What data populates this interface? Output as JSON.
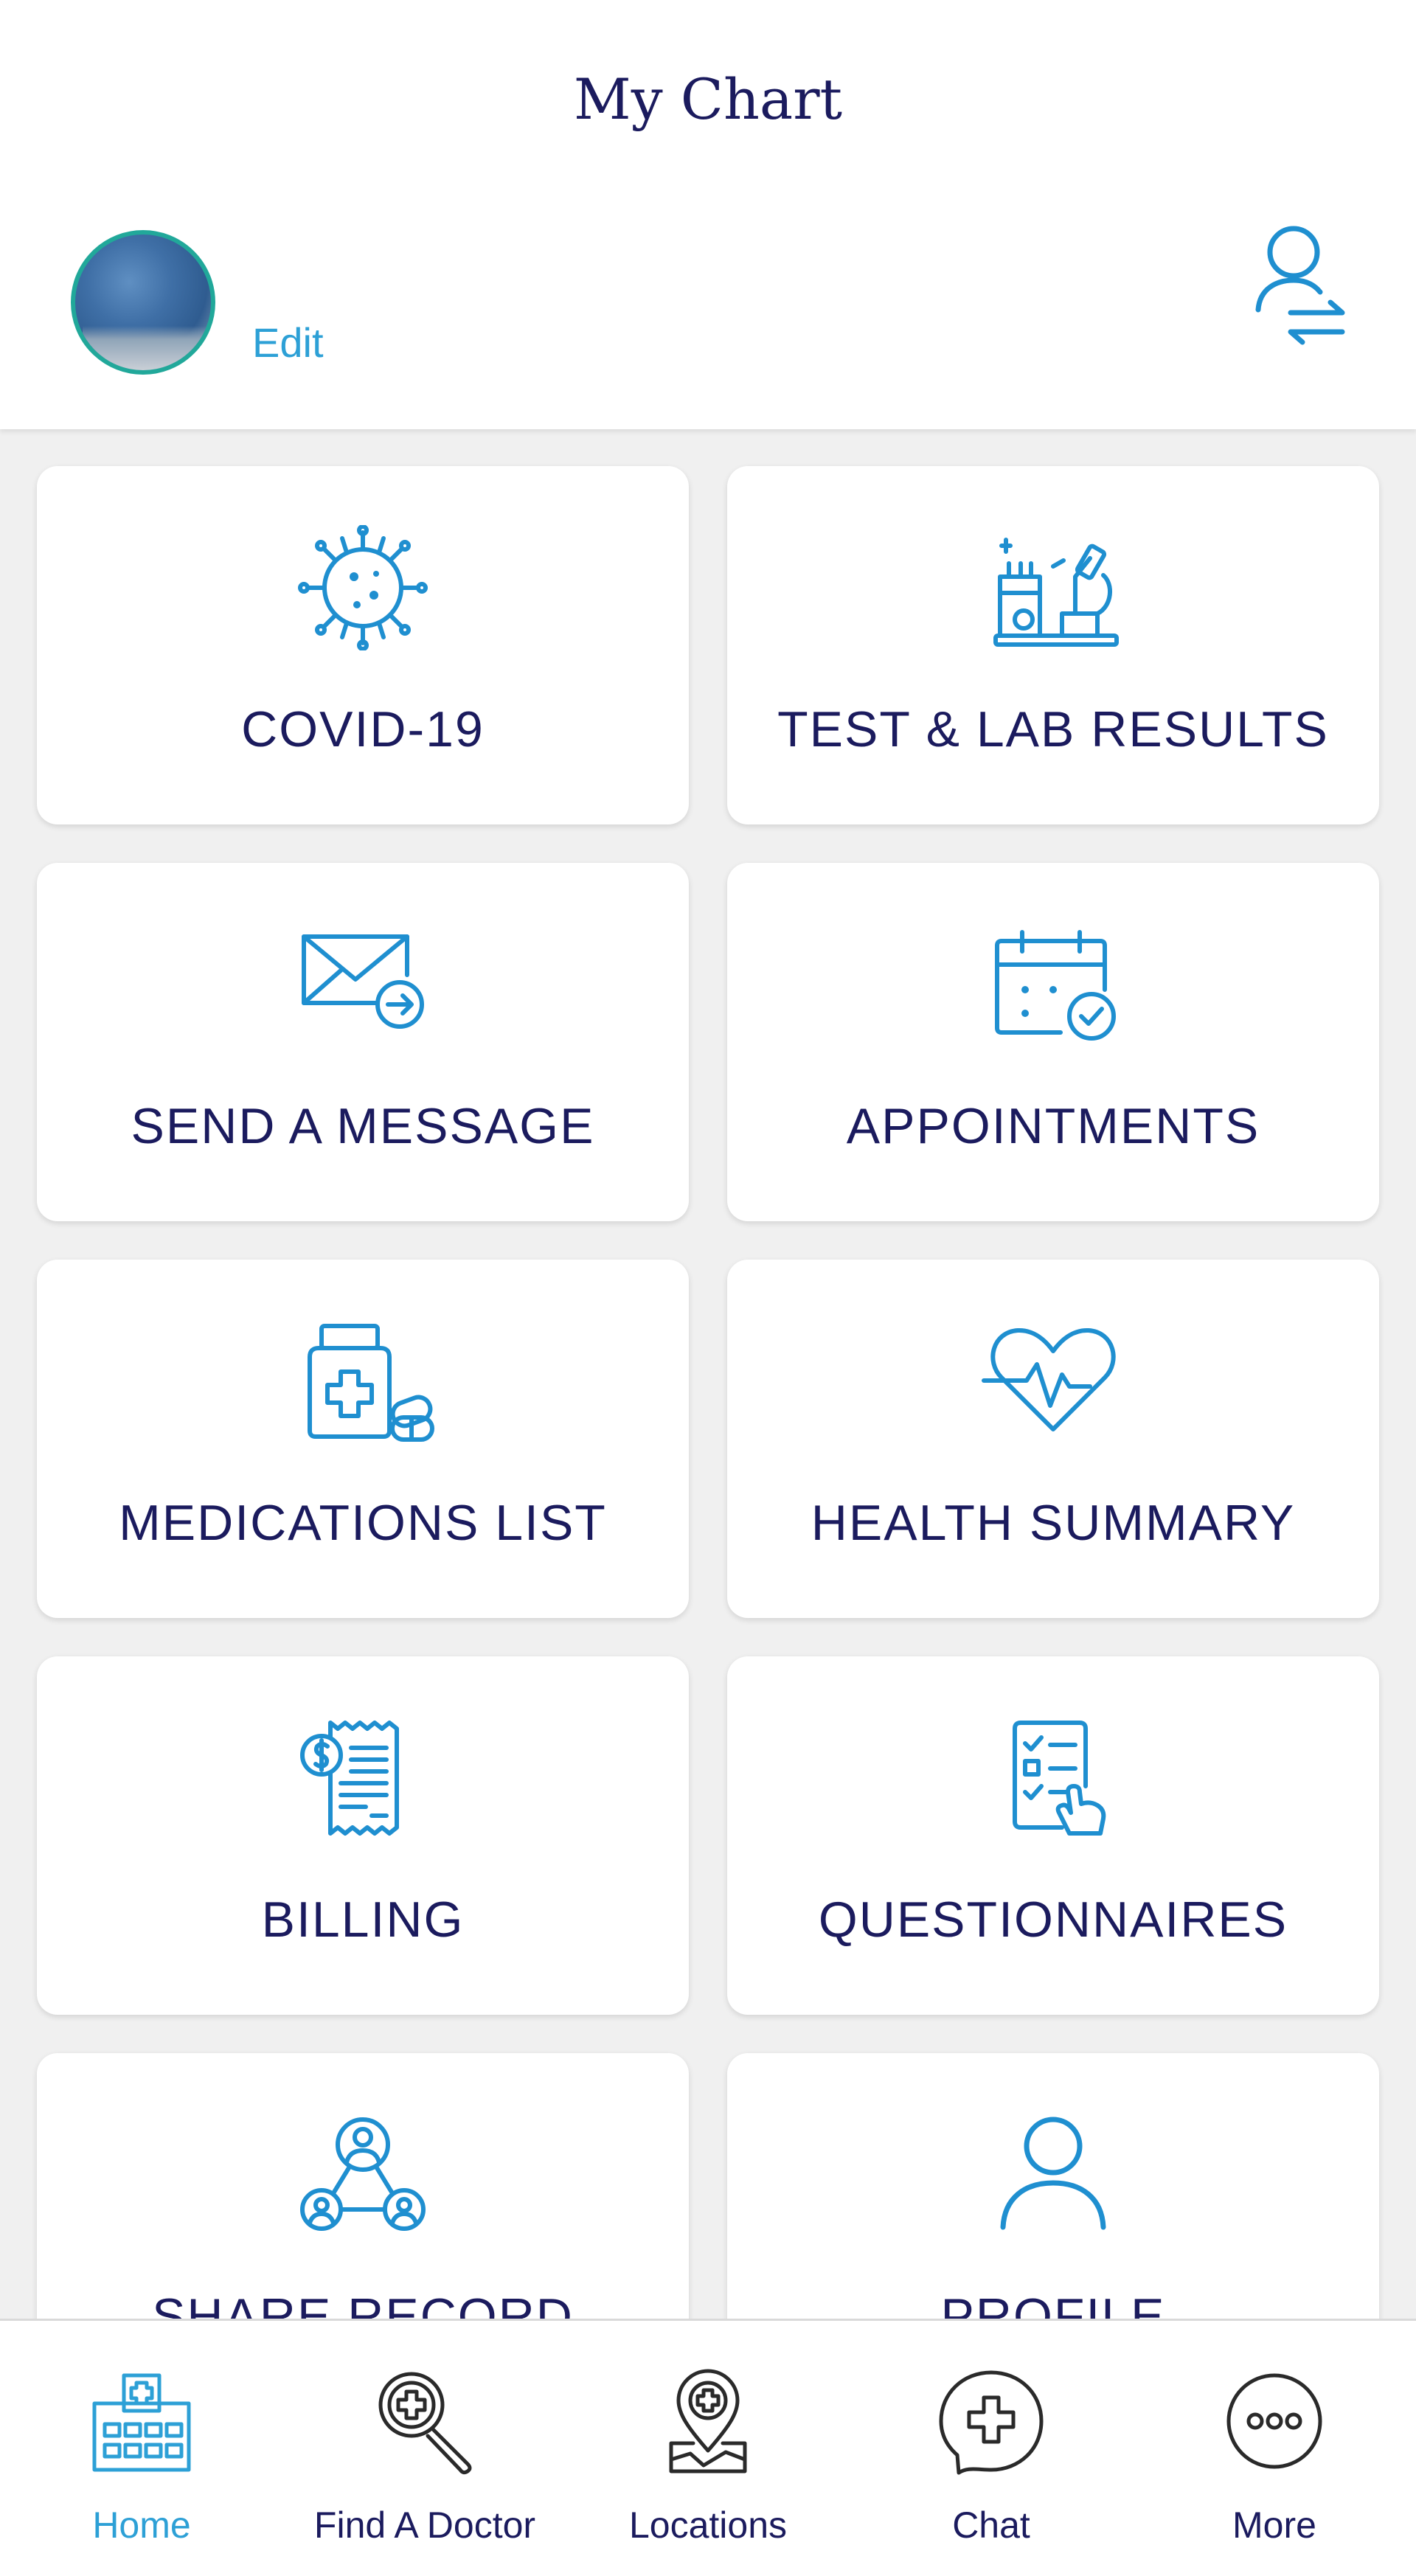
{
  "app": {
    "title": "My Chart"
  },
  "profile": {
    "edit_label": "Edit",
    "switch_icon": "switch-user-icon"
  },
  "tiles": [
    {
      "label": "COVID-19",
      "icon": "virus-icon"
    },
    {
      "label": "TEST & LAB RESULTS",
      "icon": "lab-microscope-icon"
    },
    {
      "label": "SEND A MESSAGE",
      "icon": "envelope-send-icon"
    },
    {
      "label": "APPOINTMENTS",
      "icon": "calendar-check-icon"
    },
    {
      "label": "MEDICATIONS LIST",
      "icon": "medicine-bottle-icon"
    },
    {
      "label": "HEALTH SUMMARY",
      "icon": "heart-pulse-icon"
    },
    {
      "label": "BILLING",
      "icon": "receipt-dollar-icon"
    },
    {
      "label": "QUESTIONNAIRES",
      "icon": "checklist-icon"
    },
    {
      "label": "SHARE RECORD",
      "icon": "share-people-icon"
    },
    {
      "label": "PROFILE",
      "icon": "person-icon"
    }
  ],
  "nav": {
    "items": [
      {
        "label": "Home",
        "icon": "hospital-icon",
        "active": true
      },
      {
        "label": "Find A Doctor",
        "icon": "magnifier-cross-icon",
        "active": false
      },
      {
        "label": "Locations",
        "icon": "map-pin-icon",
        "active": false
      },
      {
        "label": "Chat",
        "icon": "chat-bubble-icon",
        "active": false
      },
      {
        "label": "More",
        "icon": "more-dots-icon",
        "active": false
      }
    ]
  },
  "colors": {
    "accent": "#2da0d6",
    "icon_blue": "#1f8fd0",
    "text_navy": "#1b1b5e",
    "avatar_ring": "#21a89a",
    "background": "#f0f0f0"
  }
}
